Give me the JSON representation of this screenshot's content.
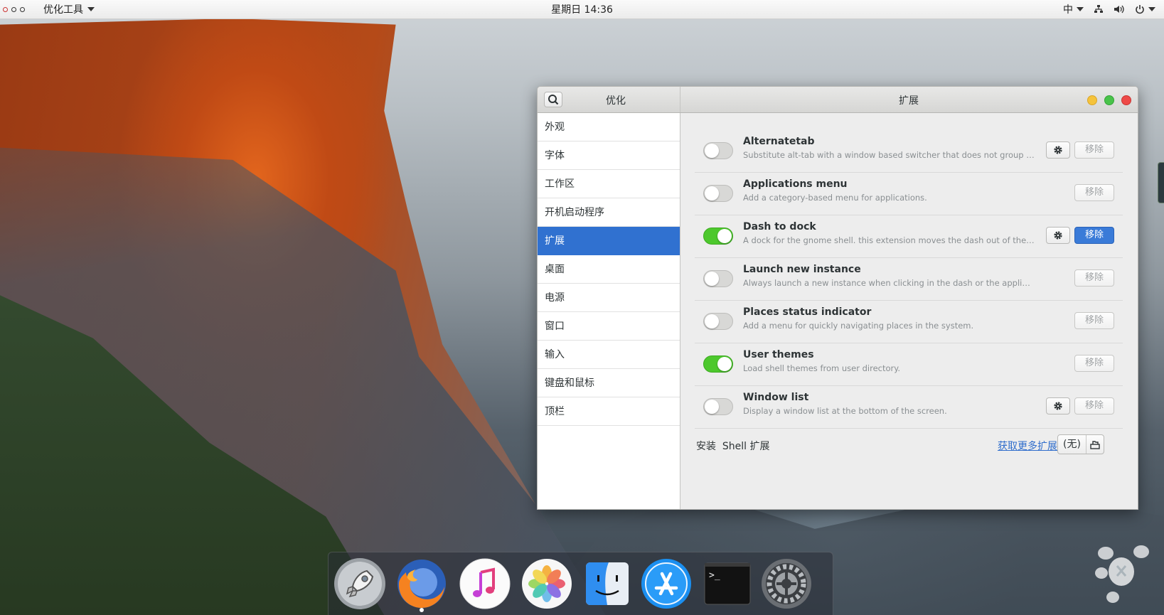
{
  "topbar": {
    "app_name": "优化工具",
    "clock": "星期日 14:36",
    "input_method": "中"
  },
  "window": {
    "sidebar_title": "优化",
    "page_title": "扩展",
    "sidebar_items": [
      {
        "label": "外观"
      },
      {
        "label": "字体"
      },
      {
        "label": "工作区"
      },
      {
        "label": "开机启动程序"
      },
      {
        "label": "扩展",
        "active": true
      },
      {
        "label": "桌面"
      },
      {
        "label": "电源"
      },
      {
        "label": "窗口"
      },
      {
        "label": "输入"
      },
      {
        "label": "键盘和鼠标"
      },
      {
        "label": "顶栏"
      }
    ],
    "extensions": [
      {
        "name": "Alternatetab",
        "description": "Substitute alt-tab with a window based switcher that does not group by ap···",
        "enabled": false,
        "has_settings": true,
        "remove_label": "移除",
        "remove_active": false
      },
      {
        "name": "Applications menu",
        "description": "Add a category-based menu for applications.",
        "enabled": false,
        "has_settings": false,
        "remove_label": "移除",
        "remove_active": false
      },
      {
        "name": "Dash to dock",
        "description": "A dock for the gnome shell. this extension moves the dash out of the overvi···",
        "enabled": true,
        "has_settings": true,
        "remove_label": "移除",
        "remove_active": true
      },
      {
        "name": "Launch new instance",
        "description": "Always launch a new instance when clicking in the dash or the application view.",
        "enabled": false,
        "has_settings": false,
        "remove_label": "移除",
        "remove_active": false
      },
      {
        "name": "Places status indicator",
        "description": "Add a menu for quickly navigating places in the system.",
        "enabled": false,
        "has_settings": false,
        "remove_label": "移除",
        "remove_active": false
      },
      {
        "name": "User themes",
        "description": "Load shell themes from user directory.",
        "enabled": true,
        "has_settings": false,
        "remove_label": "移除",
        "remove_active": false
      },
      {
        "name": "Window list",
        "description": "Display a window list at the bottom of the screen.",
        "enabled": false,
        "has_settings": true,
        "remove_label": "移除",
        "remove_active": false
      }
    ],
    "footer": {
      "install_label": "安装  Shell 扩展",
      "more_link": "获取更多扩展",
      "file_value": "(无)"
    }
  },
  "dock": {
    "items": [
      {
        "icon": "launchpad-rocket-icon"
      },
      {
        "icon": "firefox-icon",
        "running": true
      },
      {
        "icon": "music-icon"
      },
      {
        "icon": "photos-icon"
      },
      {
        "icon": "finder-icon"
      },
      {
        "icon": "app-store-icon"
      },
      {
        "icon": "terminal-icon",
        "text": ">_"
      },
      {
        "icon": "system-settings-icon"
      }
    ]
  },
  "colors": {
    "accent": "#3071d0",
    "switch_on": "#4dc82d",
    "link": "#2f6dcc"
  }
}
